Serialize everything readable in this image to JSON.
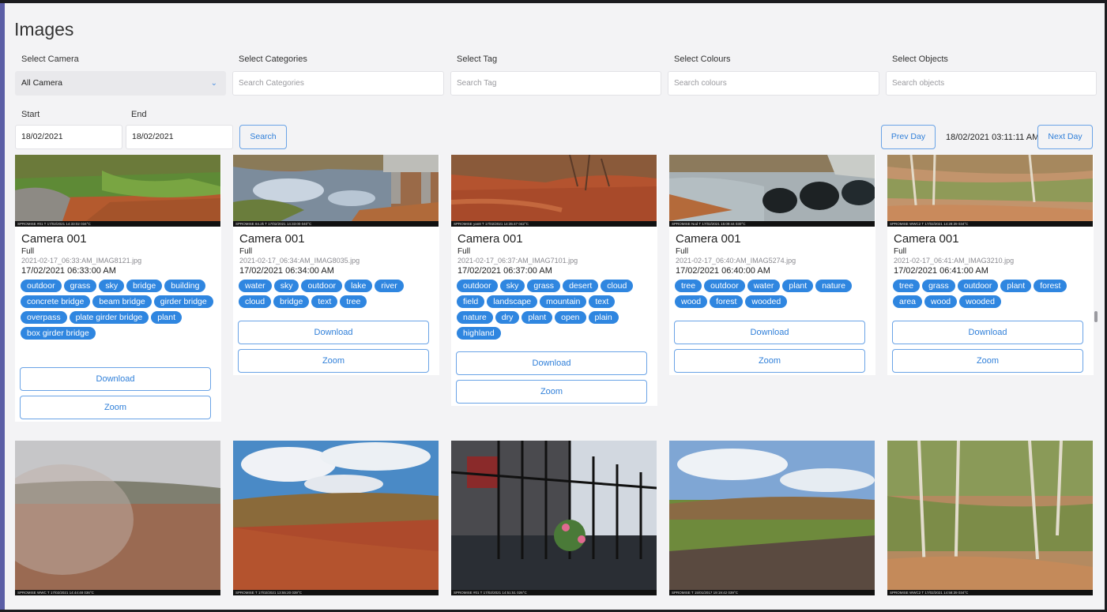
{
  "page": {
    "title": "Images"
  },
  "filters": {
    "camera": {
      "label": "Select Camera",
      "value": "All Camera"
    },
    "categories": {
      "label": "Select Categories",
      "placeholder": "Search Categories"
    },
    "tag": {
      "label": "Select Tag",
      "placeholder": "Search Tag"
    },
    "colours": {
      "label": "Select Colours",
      "placeholder": "Search colours"
    },
    "objects": {
      "label": "Select Objects",
      "placeholder": "Search objects"
    },
    "start": {
      "label": "Start",
      "value": "18/02/2021"
    },
    "end": {
      "label": "End",
      "value": "18/02/2021"
    },
    "search_label": "Search"
  },
  "day_nav": {
    "prev_label": "Prev Day",
    "current": "18/02/2021 03:11:11 AM",
    "next_label": "Next Day"
  },
  "cards": [
    {
      "camera": "Camera 001",
      "size": "Full",
      "file": "2021-02-17_06:33:AM_IMAG8121.jpg",
      "time": "17/02/2021 06:33:00 AM",
      "strip": "SPROMISE        #01        T        17/02/2021 14:33:02        034°C",
      "tags": [
        "outdoor",
        "grass",
        "sky",
        "bridge",
        "building",
        "concrete bridge",
        "beam bridge",
        "girder bridge",
        "overpass",
        "plate girder bridge",
        "plant",
        "box girder bridge"
      ],
      "download_label": "Download",
      "zoom_label": "Zoom"
    },
    {
      "camera": "Camera 001",
      "size": "Full",
      "file": "2021-02-17_06:34:AM_IMAG8035.jpg",
      "time": "17/02/2021 06:34:00 AM",
      "strip": "SPROMISE        84.2k        T        17/02/2021 14:33:00        040°C",
      "tags": [
        "water",
        "sky",
        "outdoor",
        "lake",
        "river",
        "cloud",
        "bridge",
        "text",
        "tree"
      ],
      "download_label": "Download",
      "zoom_label": "Zoom"
    },
    {
      "camera": "Camera 001",
      "size": "Full",
      "file": "2021-02-17_06:37:AM_IMAG7101.jpg",
      "time": "17/02/2021 06:37:00 AM",
      "strip": "SPROMISE        yan8        T        17/02/2021 14:35:47        042°C",
      "tags": [
        "outdoor",
        "sky",
        "grass",
        "desert",
        "cloud",
        "field",
        "landscape",
        "mountain",
        "text",
        "nature",
        "dry",
        "plant",
        "open",
        "plain",
        "highland"
      ],
      "download_label": "Download",
      "zoom_label": "Zoom"
    },
    {
      "camera": "Camera 001",
      "size": "Full",
      "file": "2021-02-17_06:40:AM_IMAG5274.jpg",
      "time": "17/02/2021 06:40:00 AM",
      "strip": "SPROMISE        Nod        T        17/02/2021 15:09:44        030°C",
      "tags": [
        "tree",
        "outdoor",
        "water",
        "plant",
        "nature",
        "wood",
        "forest",
        "wooded"
      ],
      "download_label": "Download",
      "zoom_label": "Zoom"
    },
    {
      "camera": "Camera 001",
      "size": "Full",
      "file": "2021-02-17_06:41:AM_IMAG3210.jpg",
      "time": "17/02/2021 06:41:00 AM",
      "strip": "SPROMISE        WWC2        T        17/02/2021 14:28:39        034°C",
      "tags": [
        "tree",
        "grass",
        "outdoor",
        "plant",
        "forest",
        "area",
        "wood",
        "wooded"
      ],
      "download_label": "Download",
      "zoom_label": "Zoom"
    }
  ],
  "photos": [
    {
      "strip": "SPROMISE        WWC        T        17/02/2021 14:44:48        036°C"
    },
    {
      "strip": "SPROMISE        T        17/02/2021 13:55:20        039°C"
    },
    {
      "strip": "SPROMISE        #01        T        17/02/2021 14:51:51        026°C"
    },
    {
      "strip": "SPROMISE        T        15/01/2017 19:19:42        039°C"
    },
    {
      "strip": "SPROMISE        WWC2        T        17/02/2021 14:58:39        034°C"
    }
  ],
  "colors": {
    "accent": "#2f86e0",
    "page_bg": "#f3f3f5"
  }
}
